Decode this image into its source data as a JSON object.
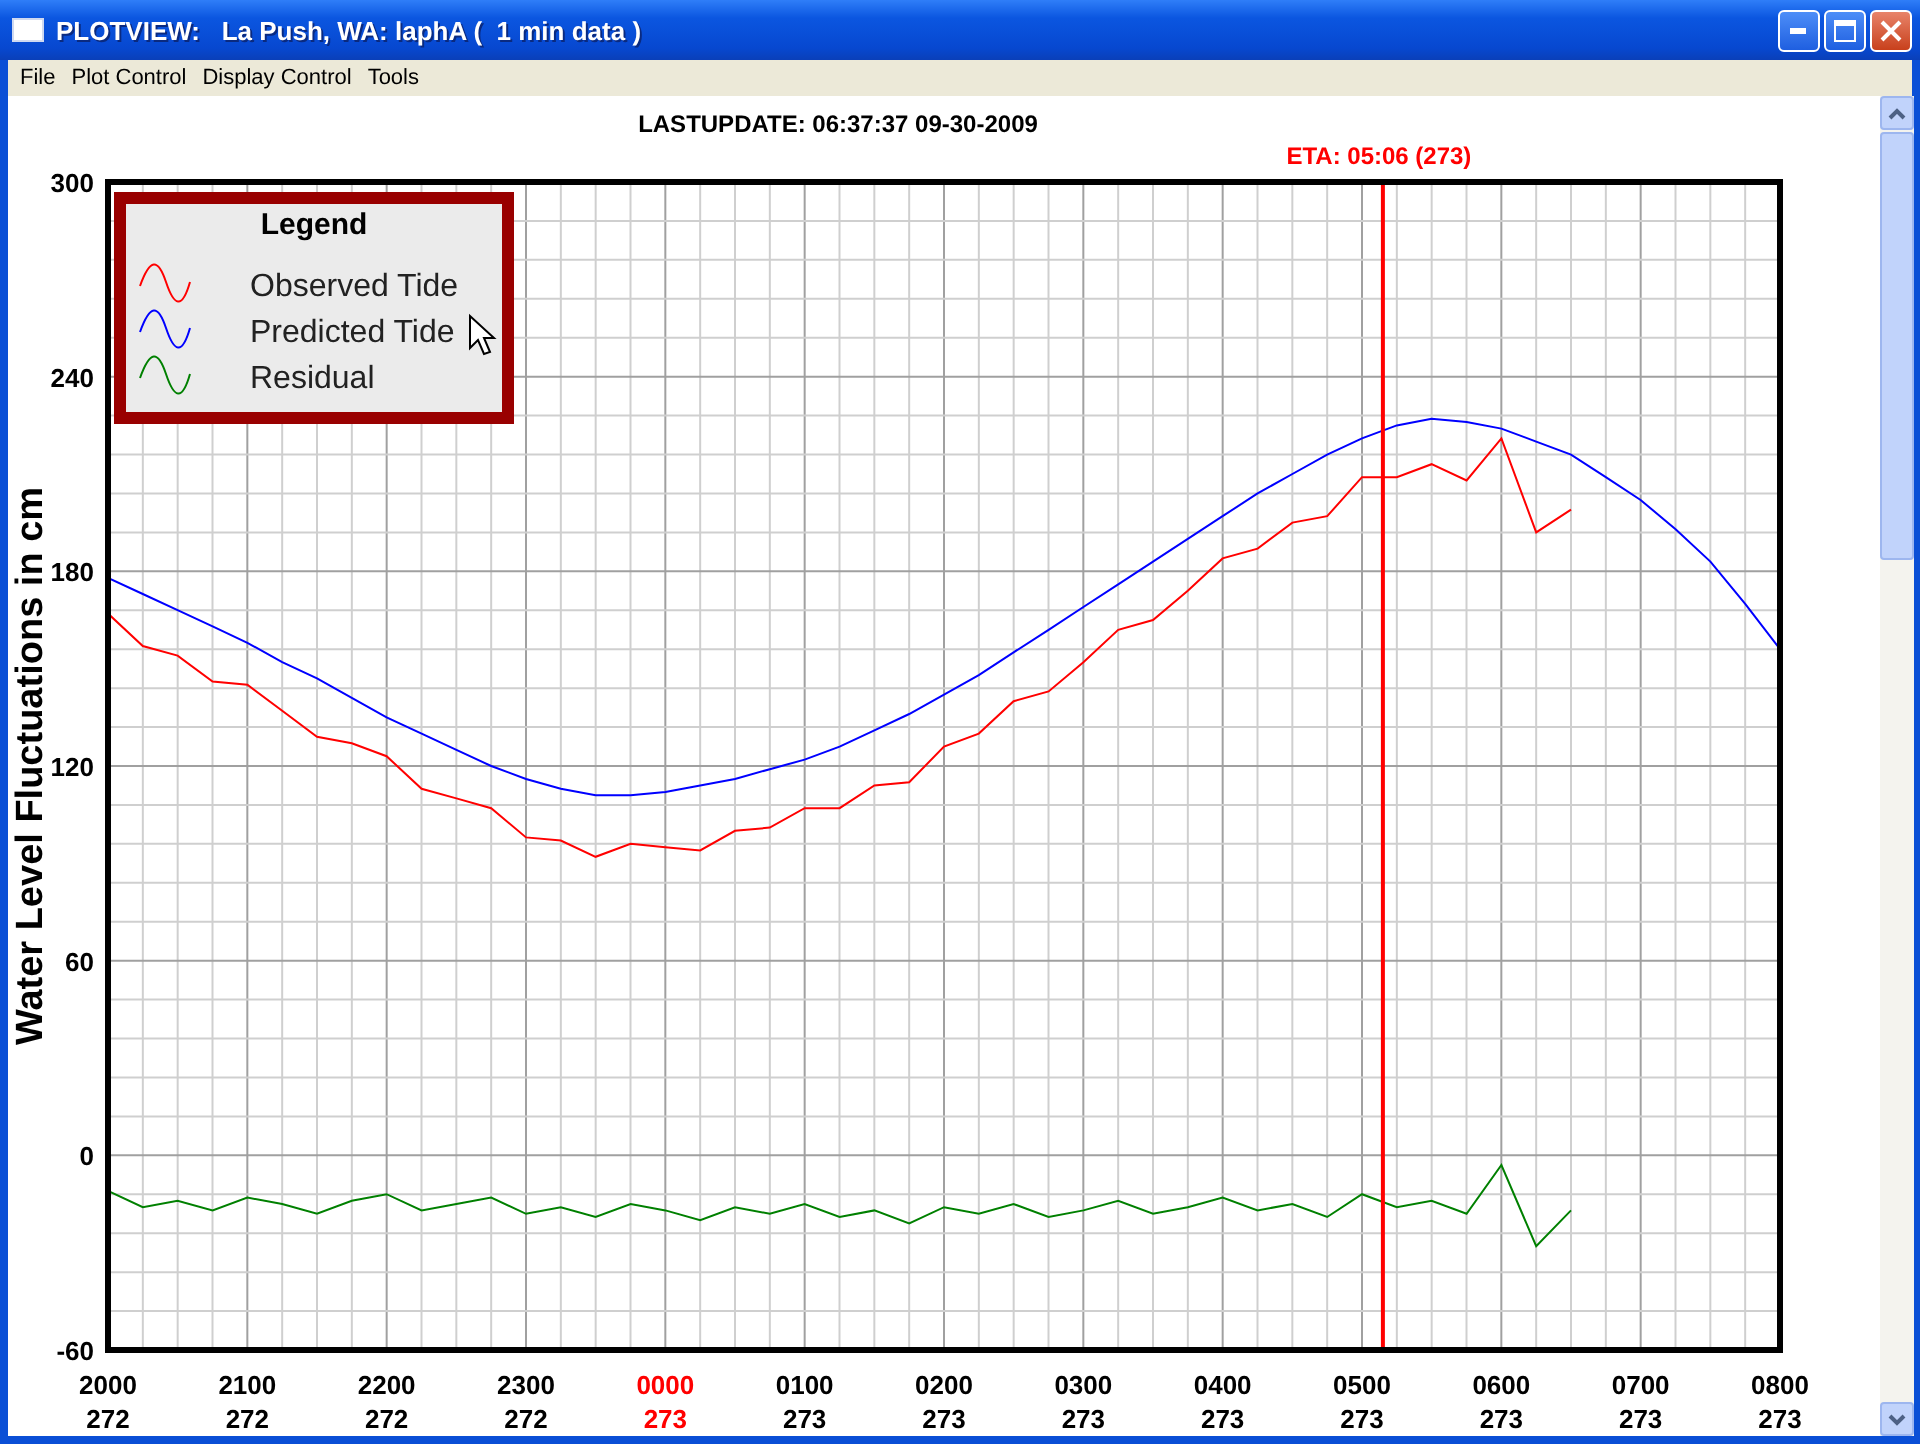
{
  "window": {
    "title": "PLOTVIEW:   La Push, WA: laphA (  1 min data )"
  },
  "menu": [
    "File",
    "Plot Control",
    "Display Control",
    "Tools"
  ],
  "plot": {
    "last_update": "LASTUPDATE: 06:37:37  09-30-2009",
    "x_days": [
      {
        "day": "272",
        "highlight": false
      },
      {
        "day": "272",
        "highlight": false
      },
      {
        "day": "272",
        "highlight": false
      },
      {
        "day": "272",
        "highlight": false
      },
      {
        "day": "273",
        "highlight": true
      },
      {
        "day": "273",
        "highlight": false
      },
      {
        "day": "273",
        "highlight": false
      },
      {
        "day": "273",
        "highlight": false
      },
      {
        "day": "273",
        "highlight": false
      },
      {
        "day": "273",
        "highlight": false
      },
      {
        "day": "273",
        "highlight": false
      },
      {
        "day": "273",
        "highlight": false
      },
      {
        "day": "273",
        "highlight": false
      }
    ],
    "legend_title": "Legend",
    "chart_data": {
      "type": "line",
      "ylabel": "Water Level Fluctuations in cm",
      "categories": [
        "2000",
        null,
        null,
        null,
        "2100",
        null,
        null,
        null,
        "2200",
        null,
        null,
        null,
        "2300",
        null,
        null,
        null,
        "0000",
        null,
        null,
        null,
        "0100",
        null,
        null,
        null,
        "0200",
        null,
        null,
        null,
        "0300",
        null,
        null,
        null,
        "0400",
        null,
        null,
        null,
        "0500",
        null,
        null,
        null,
        "0600",
        null,
        null,
        null,
        "0700",
        null,
        null,
        null,
        "0800"
      ],
      "series": [
        {
          "name": "Observed Tide",
          "color": "#ff0000",
          "values": [
            167,
            157,
            154,
            146,
            145,
            137,
            129,
            127,
            123,
            113,
            110,
            107,
            98,
            97,
            92,
            96,
            95,
            94,
            100,
            101,
            107,
            107,
            114,
            115,
            126,
            130,
            140,
            143,
            152,
            162,
            165,
            174,
            184,
            187,
            195,
            197,
            209,
            209,
            213,
            208,
            221,
            192,
            199,
            null,
            null,
            null,
            null,
            null,
            null
          ]
        },
        {
          "name": "Predicted Tide",
          "color": "#0000ff",
          "values": [
            178,
            173,
            168,
            163,
            158,
            152,
            147,
            141,
            135,
            130,
            125,
            120,
            116,
            113,
            111,
            111,
            112,
            114,
            116,
            119,
            122,
            126,
            131,
            136,
            142,
            148,
            155,
            162,
            169,
            176,
            183,
            190,
            197,
            204,
            210,
            216,
            221,
            225,
            227,
            226,
            224,
            220,
            216,
            209,
            202,
            193,
            183,
            170,
            156
          ]
        },
        {
          "name": "Residual",
          "color": "#008000",
          "values": [
            -11,
            -16,
            -14,
            -17,
            -13,
            -15,
            -18,
            -14,
            -12,
            -17,
            -15,
            -13,
            -18,
            -16,
            -19,
            -15,
            -17,
            -20,
            -16,
            -18,
            -15,
            -19,
            -17,
            -21,
            -16,
            -18,
            -15,
            -19,
            -17,
            -14,
            -18,
            -16,
            -13,
            -17,
            -15,
            -19,
            -12,
            -16,
            -14,
            -18,
            -3,
            -28,
            -17,
            null,
            null,
            null,
            null,
            null,
            null
          ]
        }
      ],
      "ylim": [
        -60,
        300
      ],
      "yticks": [
        {
          "value": -60,
          "label": "-60"
        },
        {
          "value": 0,
          "label": "0"
        },
        {
          "value": 60,
          "label": "60"
        },
        {
          "value": 120,
          "label": "120"
        },
        {
          "value": 180,
          "label": "180"
        },
        {
          "value": 240,
          "label": "240"
        },
        {
          "value": 300,
          "label": "300"
        }
      ],
      "grid": true,
      "legend": "upper left",
      "annotations": [
        "ETA: 05:06 (273)"
      ]
    }
  }
}
